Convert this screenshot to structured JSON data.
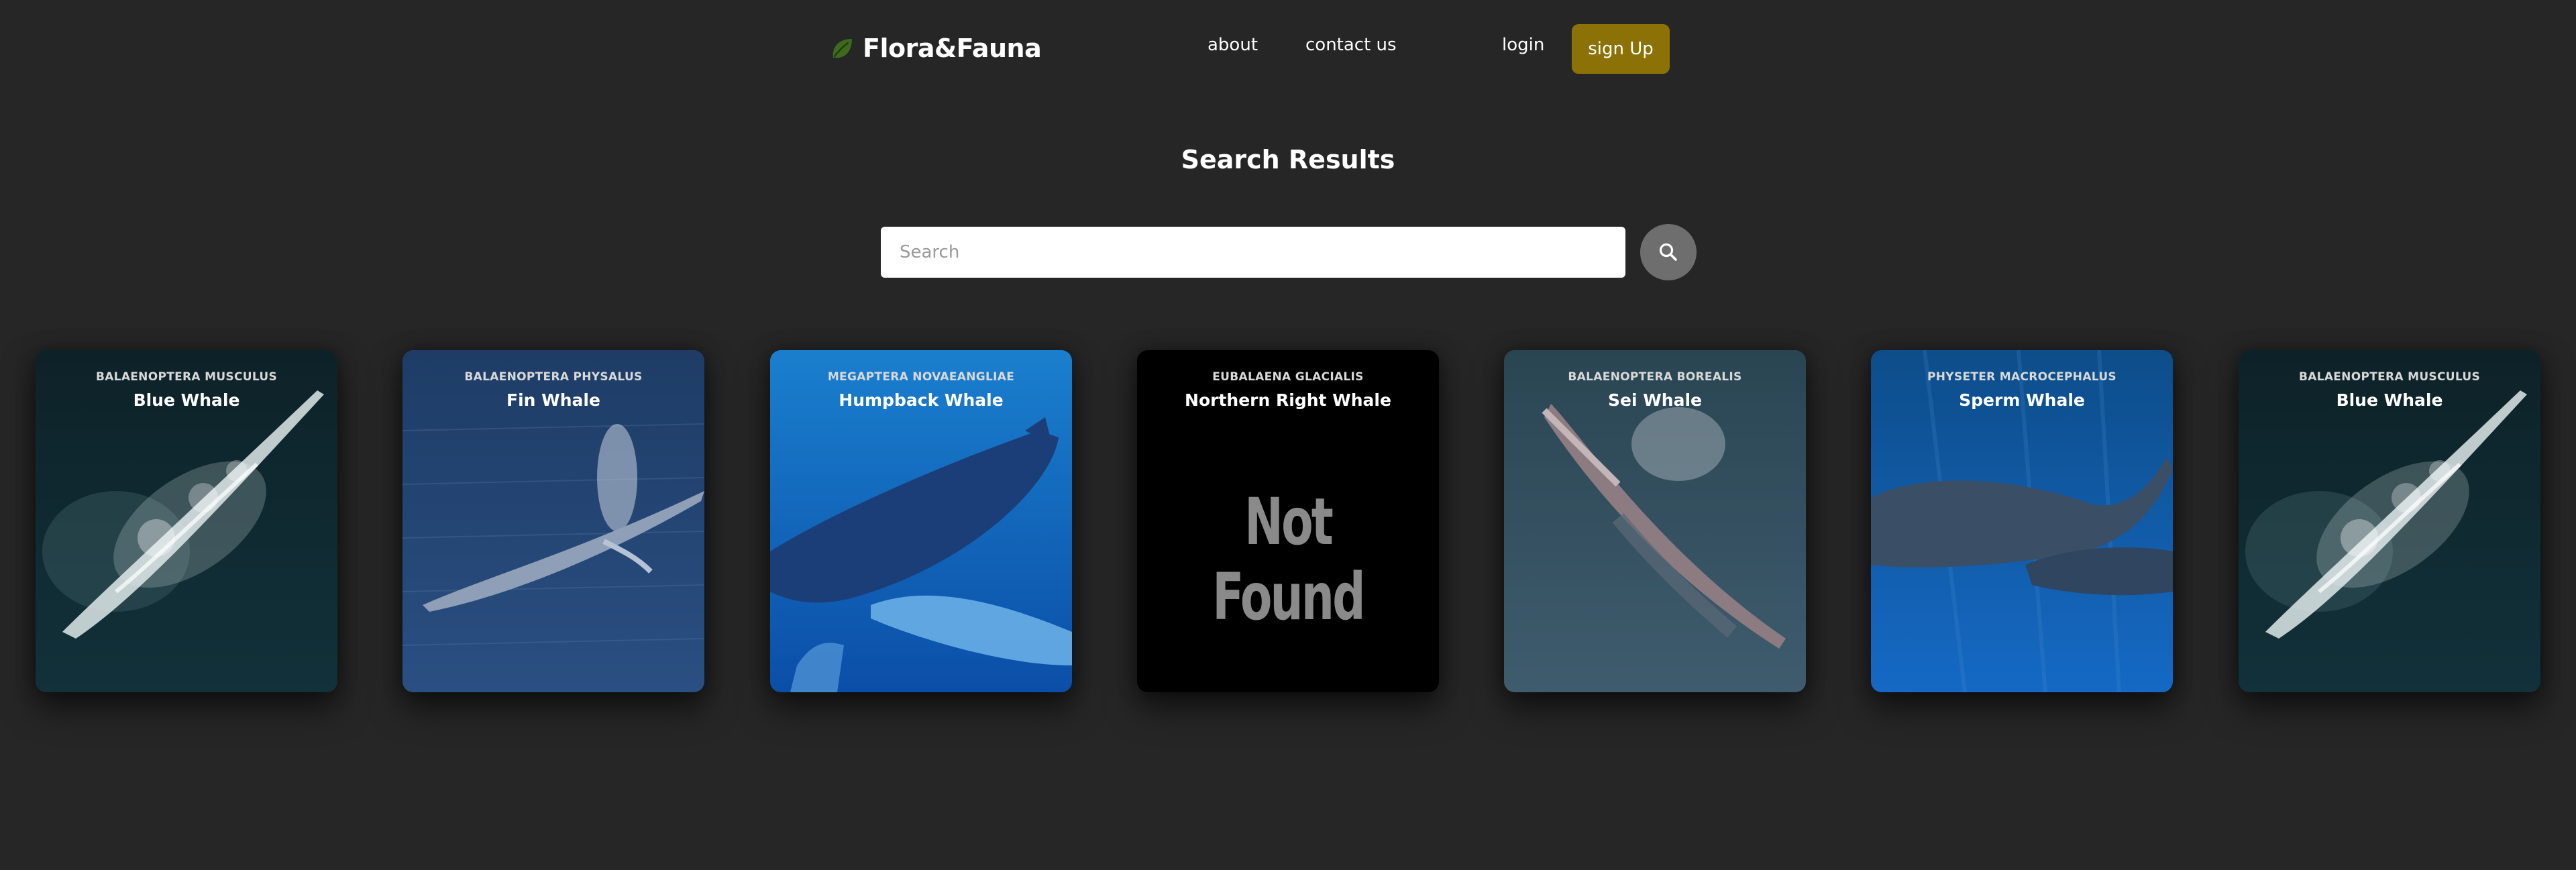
{
  "header": {
    "brand": "Flora&Fauna",
    "nav": {
      "about": "about",
      "contact": "contact us",
      "login": "login",
      "signup": "sign Up"
    },
    "colors": {
      "accent": "#8c7206",
      "leaf": "#3d6b1e"
    }
  },
  "page": {
    "title": "Search Results"
  },
  "search": {
    "placeholder": "Search",
    "value": "",
    "button_icon": "search-icon"
  },
  "results": [
    {
      "scientific": "BALAENOPTERA MUSCULUS",
      "common": "Blue Whale"
    },
    {
      "scientific": "BALAENOPTERA PHYSALUS",
      "common": "Fin Whale"
    },
    {
      "scientific": "MEGAPTERA NOVAEANGLIAE",
      "common": "Humpback Whale"
    },
    {
      "scientific": "EUBALAENA GLACIALIS",
      "common": "Northern Right Whale",
      "image_placeholder": "Not Found"
    },
    {
      "scientific": "BALAENOPTERA BOREALIS",
      "common": "Sei Whale"
    },
    {
      "scientific": "PHYSETER MACROCEPHALUS",
      "common": "Sperm Whale"
    },
    {
      "scientific": "BALAENOPTERA MUSCULUS",
      "common": "Blue Whale"
    }
  ]
}
